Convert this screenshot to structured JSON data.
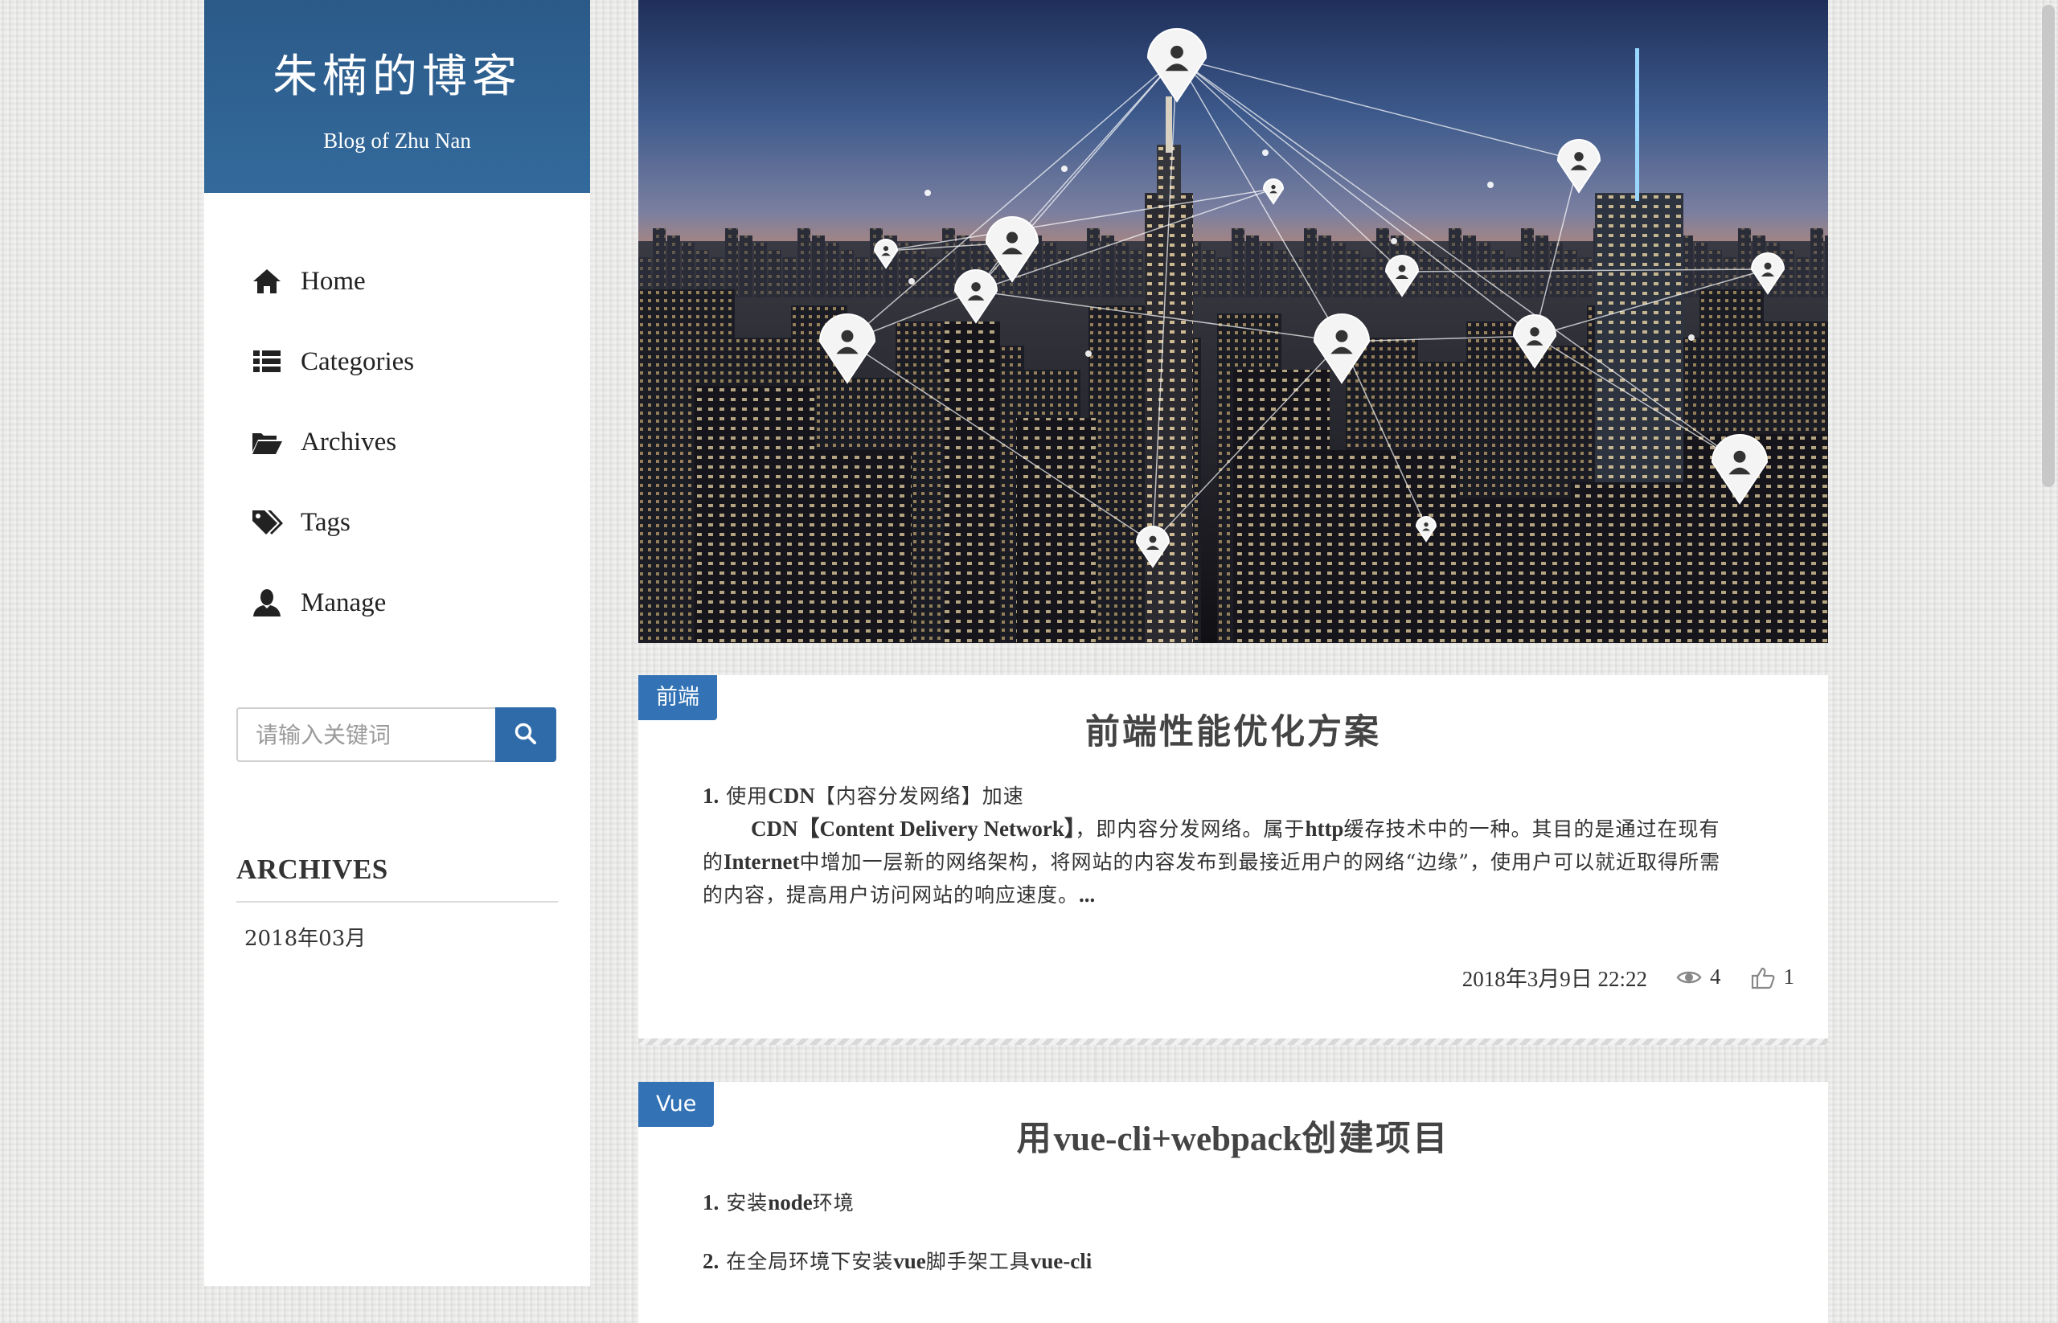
{
  "brand": {
    "title": "朱楠的博客",
    "subtitle": "Blog of Zhu Nan"
  },
  "nav": {
    "items": [
      {
        "label": "Home",
        "icon": "home-icon"
      },
      {
        "label": "Categories",
        "icon": "list-icon"
      },
      {
        "label": "Archives",
        "icon": "folder-open-icon"
      },
      {
        "label": "Tags",
        "icon": "tags-icon"
      },
      {
        "label": "Manage",
        "icon": "user-icon"
      }
    ]
  },
  "search": {
    "placeholder": "请输入关键词",
    "button_icon": "search-icon"
  },
  "archives": {
    "heading": "ARCHIVES",
    "items": [
      "2018年03月"
    ]
  },
  "banner": {
    "description_icon": "city-network-image"
  },
  "posts": [
    {
      "tag": "前端",
      "title": "前端性能优化方案",
      "line1_num": "1.",
      "line1_text": "使用",
      "line1_bold": "CDN",
      "line1_rest": "【内容分发网络】加速",
      "para_bold1": "CDN【Content Delivery Network】",
      "para_text1": "，即内容分发网络。属于",
      "para_bold2": "http",
      "para_text2": "缓存技术中的一种。其目的是通过在现有的",
      "para_bold3": "Internet",
      "para_text3": "中增加一层新的网络架构，将网站的内容发布到最接近用户的网络“边缘”，使用户可以就近取得所需的内容，提高用户访问网站的响应速度。",
      "para_ellipsis": "...",
      "date": "2018年3月9日 22:22",
      "views": "4",
      "likes": "1"
    },
    {
      "tag": "Vue",
      "title_pre": "用",
      "title_bold": "vue-cli+webpack",
      "title_post": "创建项目",
      "line1_num": "1.",
      "line1_text": "安装",
      "line1_bold": "node",
      "line1_rest": "环境",
      "line2_num": "2.",
      "line2_text": "在全局环境下安装",
      "line2_bold": "vue",
      "line2_rest": "脚手架工具",
      "line2_bold2": "vue-cli"
    }
  ],
  "colors": {
    "brand_bg": "#2e6190",
    "accent": "#3272b5"
  }
}
